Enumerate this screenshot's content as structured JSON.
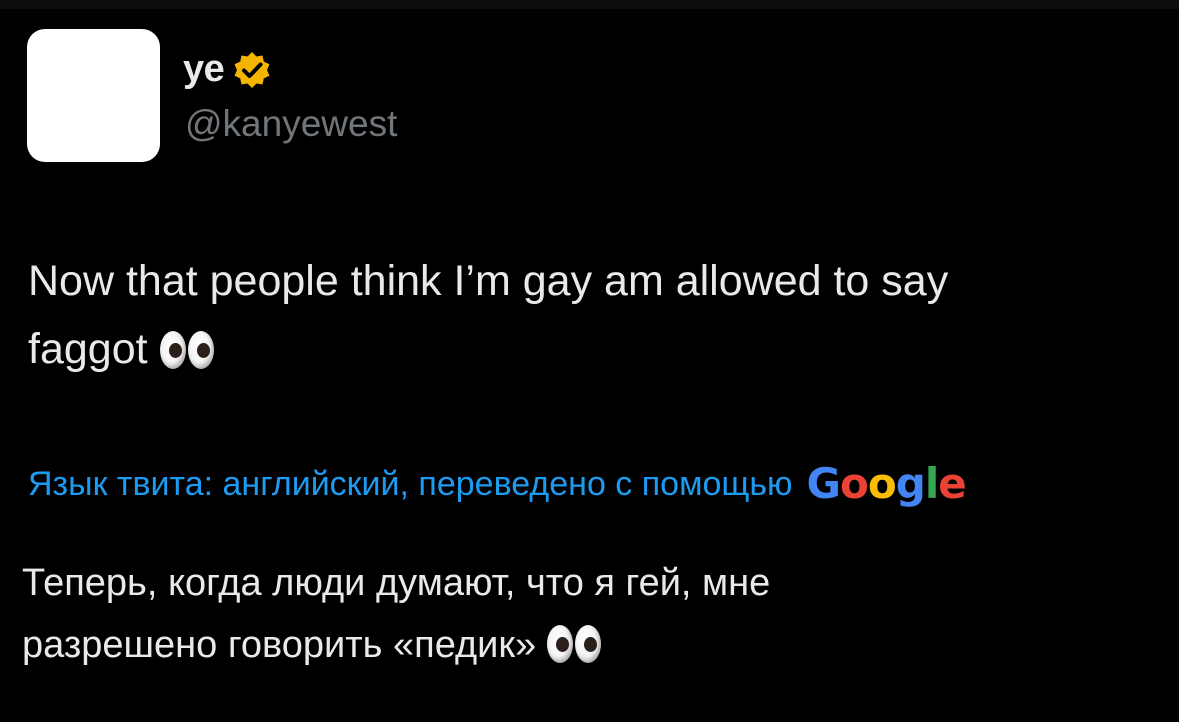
{
  "tweet": {
    "author": {
      "display_name": "ye",
      "handle": "@kanyewest",
      "verified_color": "#f4b400"
    },
    "text_line1": "Now that people think I’m gay am allowed to say",
    "text_line2": "faggot",
    "emoji": "eyes-emoji",
    "translation": {
      "label": "Язык твита: английский, переведено с помощью",
      "provider": "Google",
      "text_line1": "Теперь, когда люди думают, что я гей, мне",
      "text_line2": "разрешено говорить «педик»"
    }
  },
  "theme": {
    "background": "#000000",
    "text": "#e7e9ea",
    "secondary_text": "#71767b",
    "link": "#1d9bf0"
  }
}
